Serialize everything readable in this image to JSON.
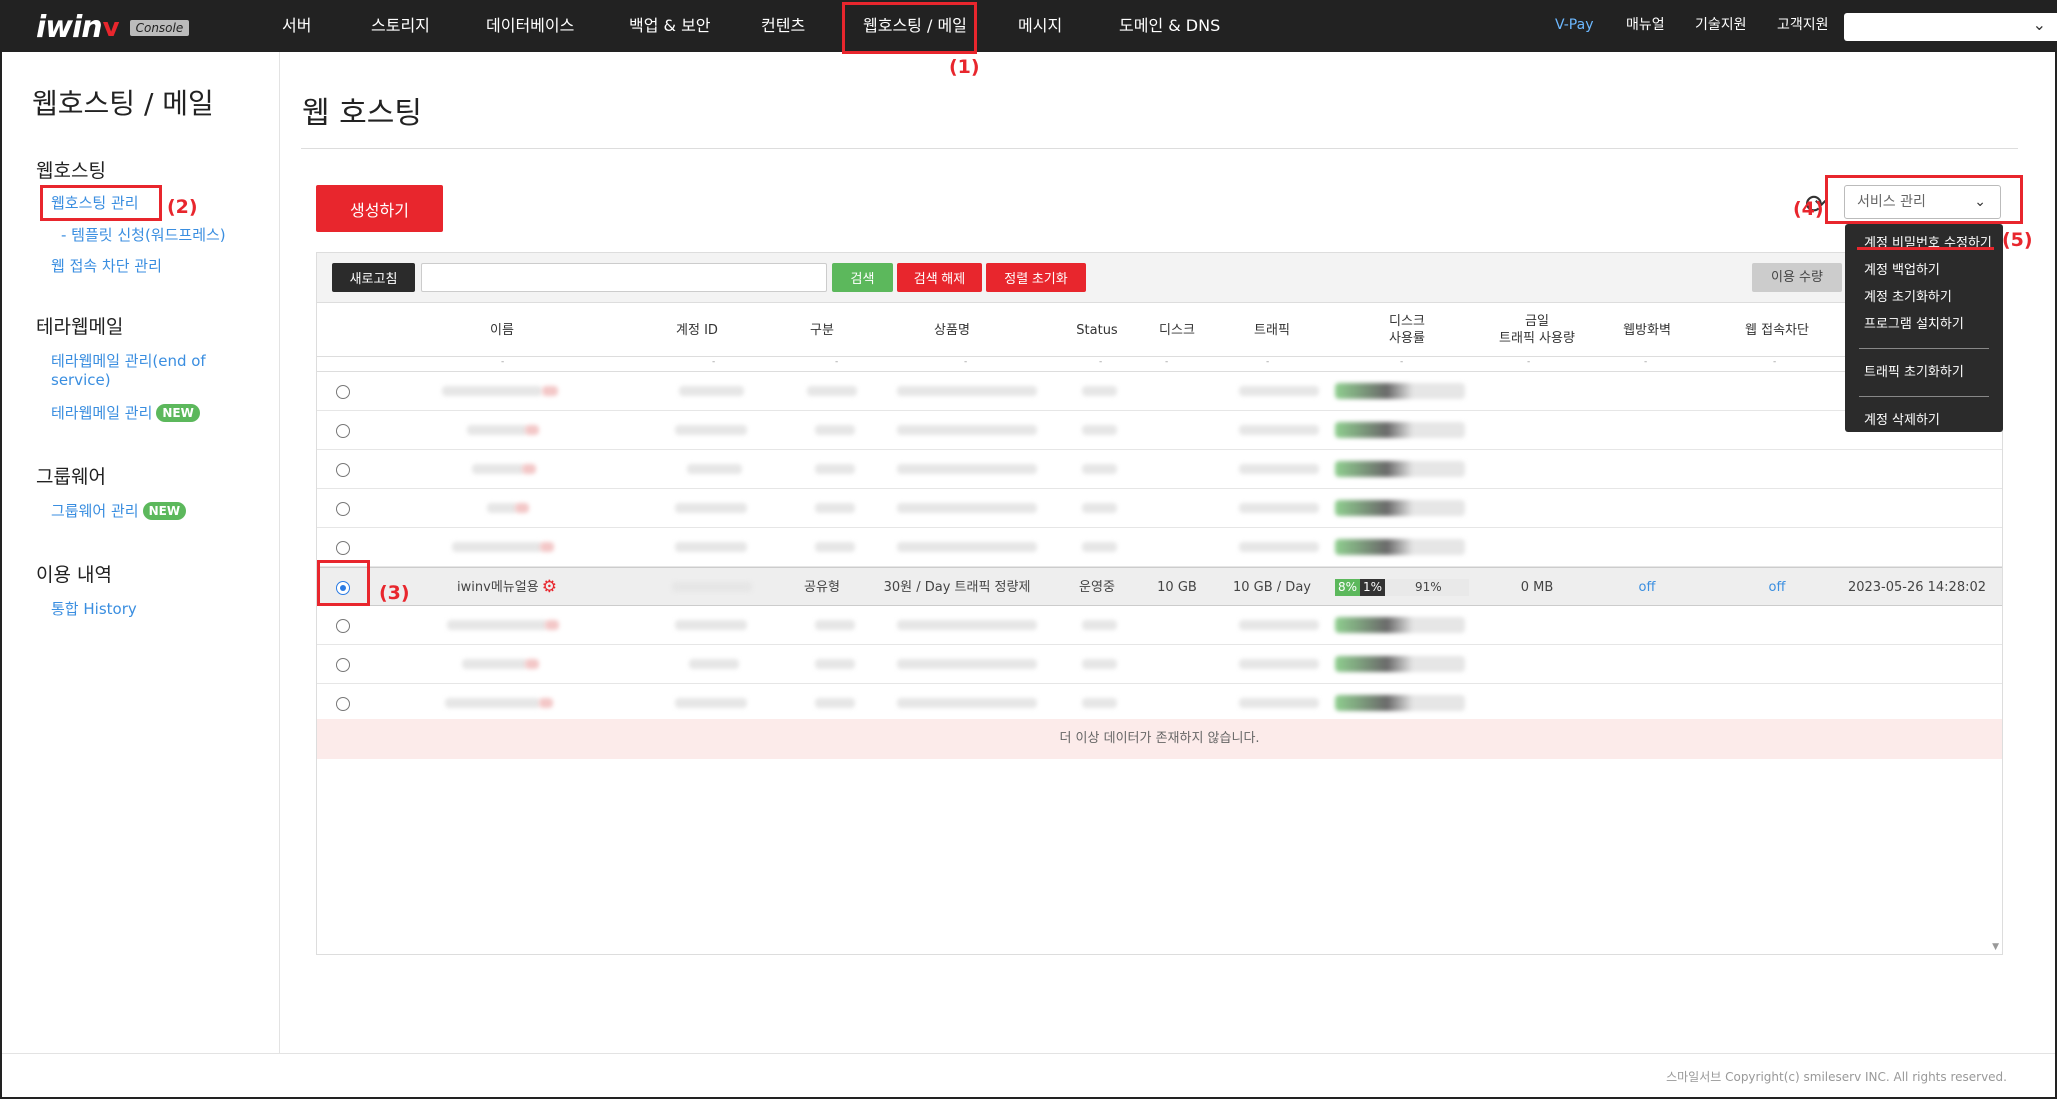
{
  "brand": {
    "logo_text": "iwin",
    "logo_mark": "v",
    "logo_badge": "Console"
  },
  "top_nav": {
    "items": [
      "서버",
      "스토리지",
      "데이터베이스",
      "백업 & 보안",
      "컨텐츠",
      "웹호스팅 / 메일",
      "메시지",
      "도메인 & DNS"
    ],
    "right": [
      "V-Pay",
      "매뉴얼",
      "기술지원",
      "고객지원"
    ],
    "select_value": ""
  },
  "annotations": [
    "(1)",
    "(2)",
    "(3)",
    "(4)",
    "(5)"
  ],
  "sidebar": {
    "title": "웹호스팅 / 메일",
    "sections": [
      {
        "label": "웹호스팅",
        "items": [
          "웹호스팅 관리",
          "- 템플릿 신청(워드프레스)",
          "웹 접속 차단 관리"
        ]
      },
      {
        "label": "테라웹메일",
        "items": [
          "테라웹메일 관리(end of",
          "service)",
          "테라웹메일 관리"
        ]
      },
      {
        "label": "그룹웨어",
        "items": [
          "그룹웨어 관리"
        ]
      },
      {
        "label": "이용 내역",
        "items": [
          "통합 History"
        ]
      }
    ],
    "new_badge": "NEW"
  },
  "main": {
    "title": "웹 호스팅",
    "create_button": "생성하기",
    "service_select": "서비스 관리",
    "dropdown": [
      "계정 비밀번호 수정하기",
      "계정 백업하기",
      "계정 초기화하기",
      "프로그램 설치하기",
      "트래픽 초기화하기",
      "계정 삭제하기"
    ],
    "toolbar": {
      "refresh": "새로고침",
      "search": "검색",
      "search_clear": "검색 해제",
      "sort_reset": "정렬 초기화",
      "usage": "이용 수량"
    },
    "columns": [
      "이름",
      "계정 ID",
      "구분",
      "상품명",
      "Status",
      "디스크",
      "트래픽",
      "디스크\n사용률",
      "금일\n트래픽 사용량",
      "웹방화벽",
      "웹 접속차단"
    ],
    "filter_dash": "-",
    "selected_row": {
      "name": "iwinv메뉴얼용",
      "type": "공유형",
      "product": "30원 / Day 트래픽 정량제",
      "status": "운영중",
      "disk": "10 GB",
      "traffic": "10 GB / Day",
      "disk_seg1": "8%",
      "disk_seg2": "1%",
      "disk_rest": "91%",
      "today_traffic": "0 MB",
      "waf": "off",
      "block": "off",
      "date": "2023-05-26 14:28:02"
    },
    "no_more": "더 이상 데이터가 존재하지 않습니다."
  },
  "footer": {
    "copyright": "스마일서브 Copyright(c) smileserv INC. All rights reserved."
  },
  "colors": {
    "accent_red": "#e8262d",
    "link_blue": "#3a8ee0",
    "green": "#5cb85c",
    "topbar": "#222222"
  }
}
